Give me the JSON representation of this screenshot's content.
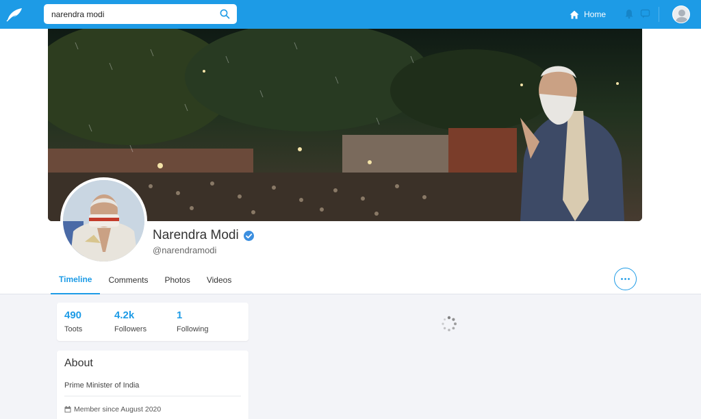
{
  "search": {
    "value": "narendra modi",
    "placeholder": ""
  },
  "nav": {
    "home_label": "Home"
  },
  "profile": {
    "name": "Narendra Modi",
    "handle": "@narendramodi",
    "verified": true
  },
  "tabs": [
    {
      "label": "Timeline",
      "active": true
    },
    {
      "label": "Comments",
      "active": false
    },
    {
      "label": "Photos",
      "active": false
    },
    {
      "label": "Videos",
      "active": false
    }
  ],
  "stats": [
    {
      "value": "490",
      "label": "Toots"
    },
    {
      "value": "4.2k",
      "label": "Followers"
    },
    {
      "value": "1",
      "label": "Following"
    }
  ],
  "about": {
    "title": "About",
    "bio": "Prime Minister of India",
    "member_since": "Member since August 2020"
  },
  "colors": {
    "accent": "#1d9be6",
    "background": "#f3f4f8"
  },
  "icons": [
    "feather-logo-icon",
    "search-icon",
    "home-icon",
    "bell-icon",
    "chat-icon",
    "user-avatar-icon",
    "verified-icon",
    "more-options-icon",
    "calendar-icon",
    "loading-spinner-icon"
  ]
}
